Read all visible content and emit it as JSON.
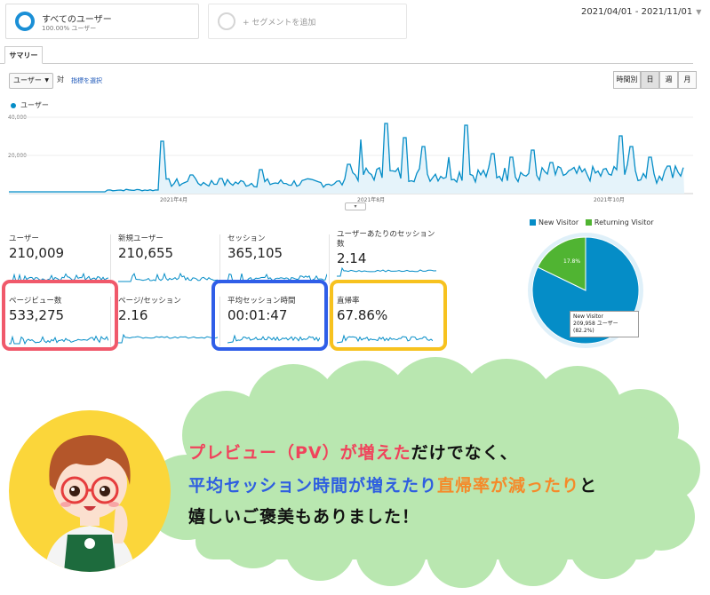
{
  "segments": {
    "all_users_title": "すべてのユーザー",
    "all_users_sub": "100.00% ユーザー",
    "add_segment": "+ セグメントを追加"
  },
  "date_range": "2021/04/01 - 2021/11/01",
  "tabs": {
    "summary": "サマリー"
  },
  "controls": {
    "metric_select": "ユーザー",
    "vs_label": "対",
    "pick_metric": "指標を選択",
    "granularity": [
      "時間別",
      "日",
      "週",
      "月"
    ],
    "active_granularity": "日"
  },
  "main_chart": {
    "legend": "ユーザー",
    "y_ticks": [
      "40,000",
      "20,000"
    ],
    "x_ticks": [
      "2021年4月",
      "2021年8月",
      "2021年10月"
    ],
    "color": "#058dc7",
    "fill": "#e5f3fa"
  },
  "metrics": [
    {
      "label": "ユーザー",
      "value": "210,009"
    },
    {
      "label": "新規ユーザー",
      "value": "210,655"
    },
    {
      "label": "セッション",
      "value": "365,105"
    },
    {
      "label": "ユーザーあたりのセッション数",
      "value": "2.14"
    },
    {
      "label": "ページビュー数",
      "value": "533,275"
    },
    {
      "label": "ページ/セッション",
      "value": "2.16"
    },
    {
      "label": "平均セッション時間",
      "value": "00:01:47"
    },
    {
      "label": "直帰率",
      "value": "67.86%"
    }
  ],
  "highlight_colors": {
    "pageviews": "#f0596b",
    "session_time": "#2f5ee8",
    "bounce": "#f7c21f"
  },
  "pie": {
    "legend": [
      {
        "name": "New Visitor",
        "color": "#058dc7"
      },
      {
        "name": "Returning Visitor",
        "color": "#50b432"
      }
    ],
    "returning_label": "17.8%",
    "tooltip_title": "New Visitor",
    "tooltip_value": "209,958 ユーザー (82.2%)",
    "chart_data": {
      "type": "pie",
      "categories": [
        "New Visitor",
        "Returning Visitor"
      ],
      "values": [
        82.2,
        17.8
      ]
    }
  },
  "message": {
    "line1_red": "プレビュー（PV）が増えた",
    "line1_rest": "だけでなく、",
    "line2_blue": "平均セッション時間が増えたり",
    "line2_orange": "直帰率が減ったり",
    "line2_rest": "と",
    "line3": "嬉しいご褒美もありました！"
  }
}
